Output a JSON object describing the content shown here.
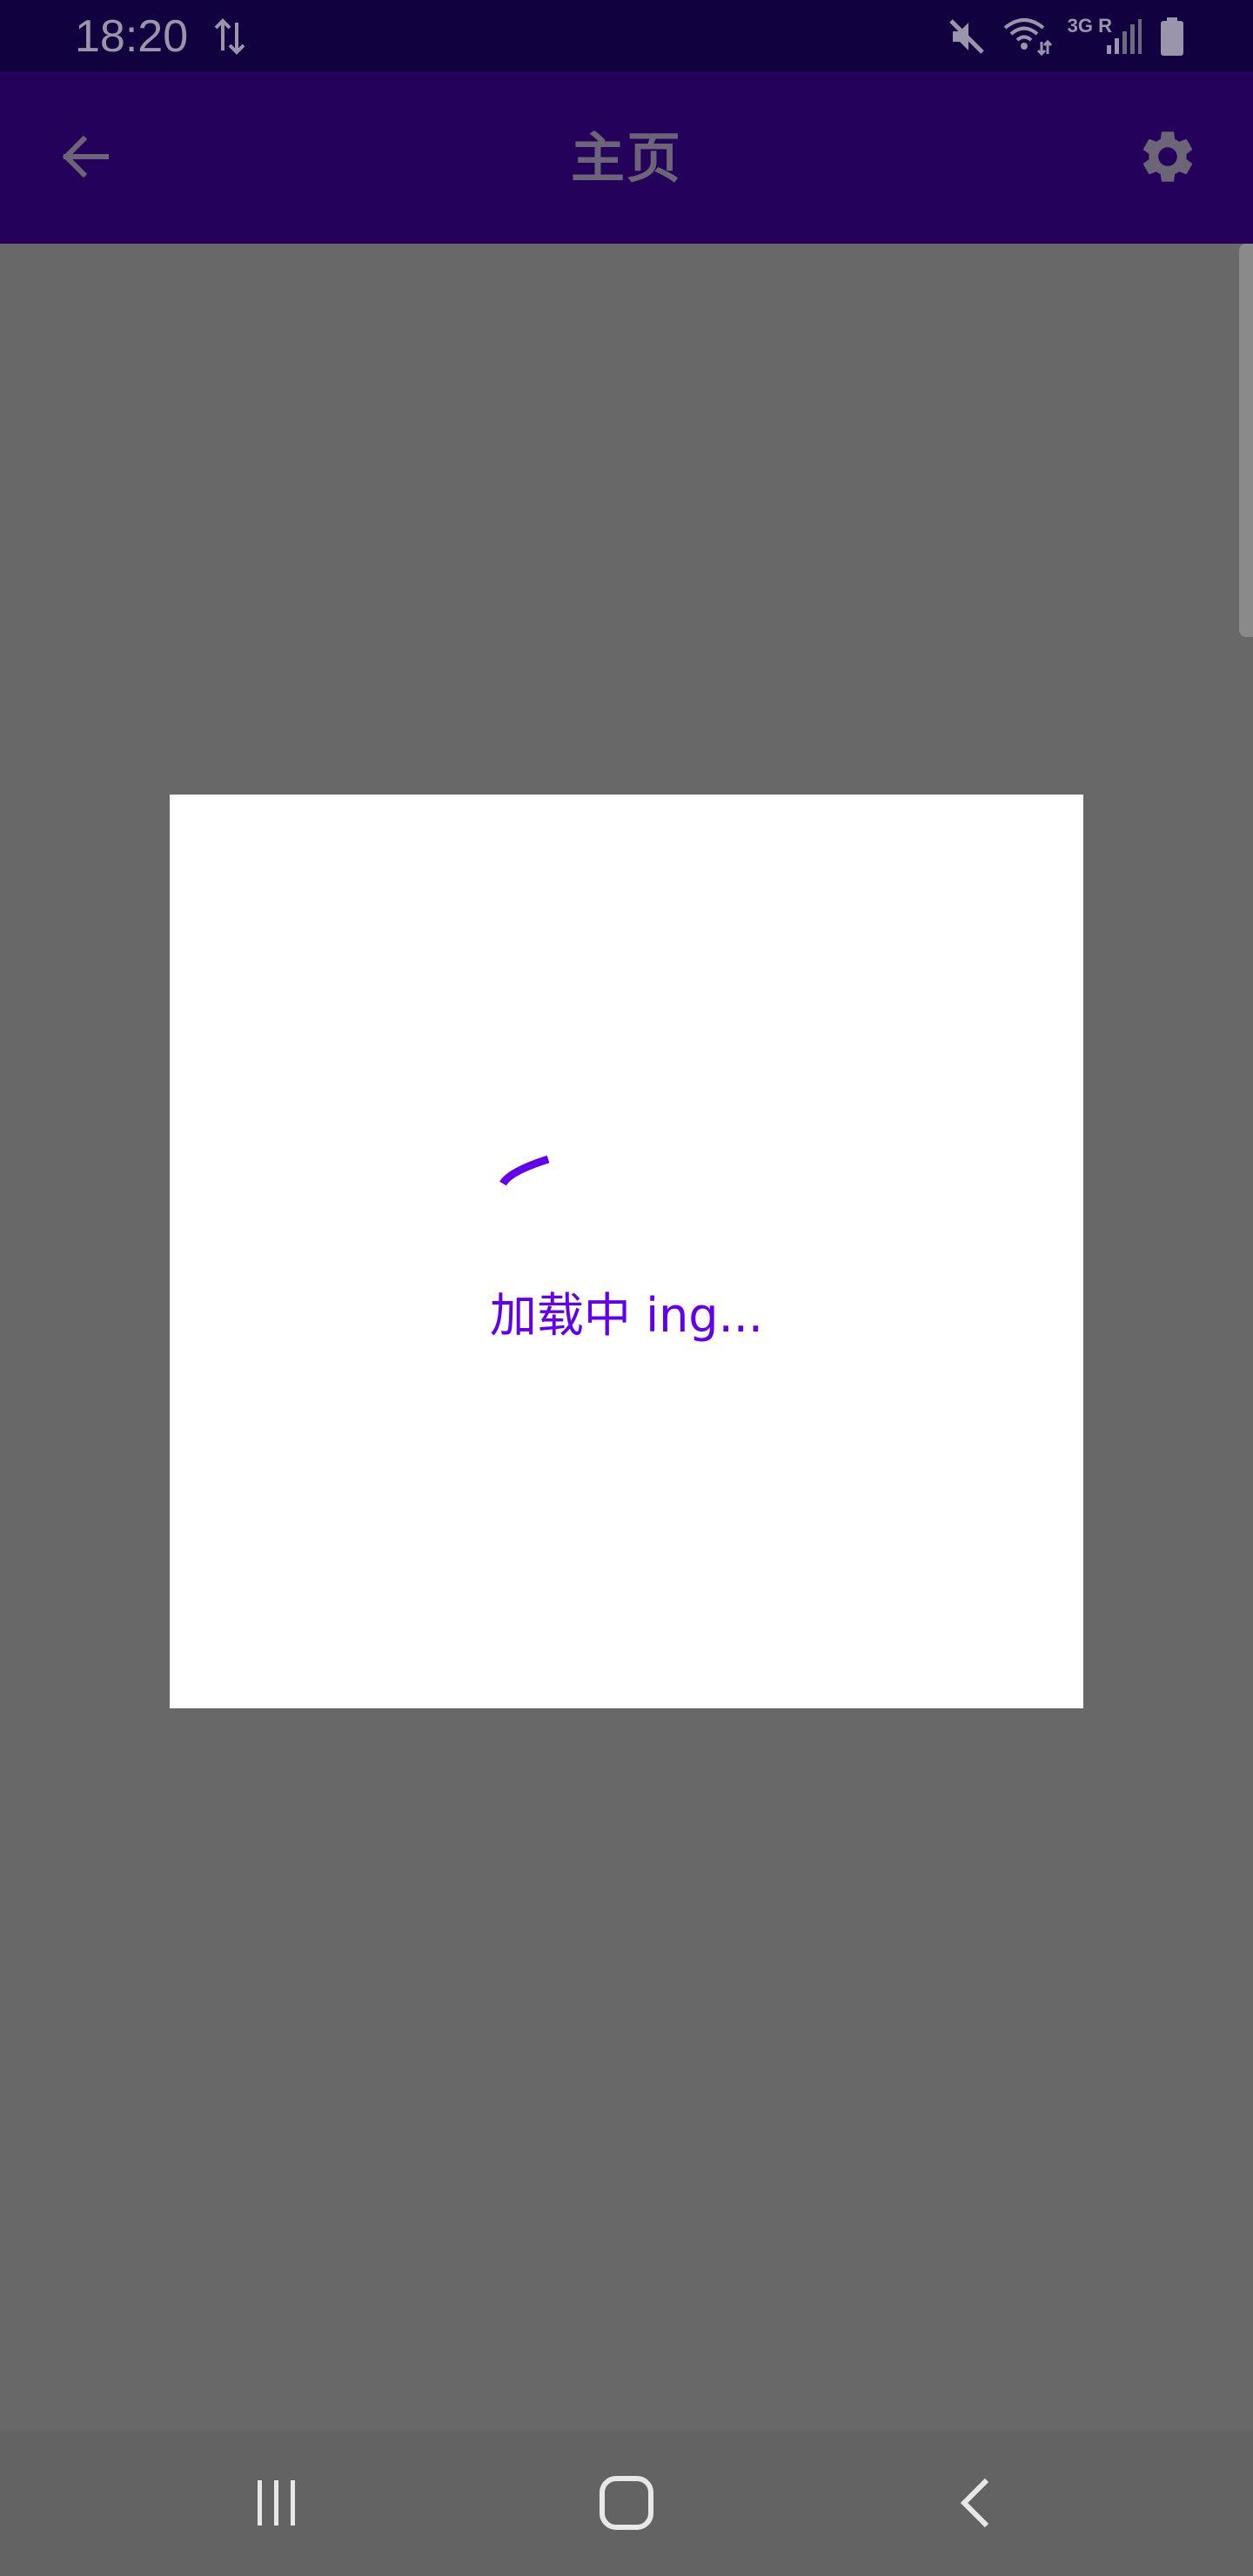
{
  "status_bar": {
    "time": "18:20",
    "network_label": "3G R",
    "icons": [
      "data-sync-icon",
      "mute-icon",
      "wifi-icon",
      "cell-signal-icon",
      "battery-icon"
    ]
  },
  "app_bar": {
    "title": "主页",
    "back_icon": "arrow-back-icon",
    "settings_icon": "gear-icon"
  },
  "dialog": {
    "loading_text": "加载中 ing...",
    "spinner_icon": "progress-spinner-icon"
  },
  "nav_bar": {
    "icons": [
      "recent-apps-icon",
      "home-icon",
      "back-icon"
    ]
  },
  "colors": {
    "status_bar_bg": "#12013f",
    "app_bar_bg": "#24015a",
    "scrim_bg": "#686868",
    "accent": "#6200ee",
    "dialog_bg": "#ffffff"
  }
}
